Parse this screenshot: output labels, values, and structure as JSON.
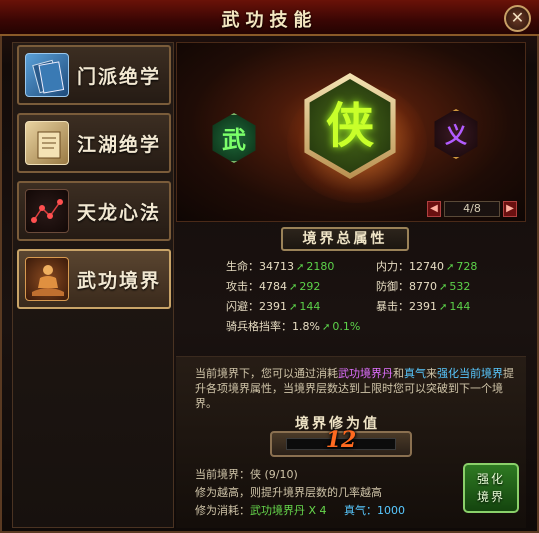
{
  "window": {
    "title": "武功技能"
  },
  "nav": [
    {
      "label": "门派绝学",
      "icon": "book-icon"
    },
    {
      "label": "江湖绝学",
      "icon": "scroll-icon"
    },
    {
      "label": "天龙心法",
      "icon": "constellation-icon"
    },
    {
      "label": "武功境界",
      "icon": "meditation-icon",
      "active": true
    }
  ],
  "realm": {
    "left_char": "武",
    "center_char": "侠",
    "right_char": "义",
    "page": "4/8"
  },
  "attributes": {
    "title": "境界总属性",
    "rows": [
      {
        "label": "生命：",
        "value": "34713",
        "gain": "2180"
      },
      {
        "label": "内力：",
        "value": "12740",
        "gain": "728"
      },
      {
        "label": "攻击：",
        "value": "4784",
        "gain": "292"
      },
      {
        "label": "防御：",
        "value": "8770",
        "gain": "532"
      },
      {
        "label": "闪避：",
        "value": "2391",
        "gain": "144"
      },
      {
        "label": "暴击：",
        "value": "2391",
        "gain": "144"
      },
      {
        "label": "骑兵格挡率：",
        "value": "1.8%",
        "gain": "0.1%"
      }
    ]
  },
  "description": {
    "p1": "当前境界下，您可以通过消耗",
    "item1": "武功境界丹",
    "p2": "和",
    "item2": "真气",
    "p3": "来",
    "item3": "强化当前境界",
    "p4": "提升各项境界属性，当境界层数达到上限时您可以突破到下一个境界。"
  },
  "cultivation": {
    "title": "境界修为值",
    "value": "12",
    "progress": 0
  },
  "status": {
    "current_label": "当前境界：侠 (9/10)",
    "hint": "修为越高，则提升境界层数的几率越高",
    "cost_label": "修为消耗：",
    "cost_item": "武功境界丹 X 4",
    "cost_qi": "真气：1000"
  },
  "buttons": {
    "upgrade_line1": "强化",
    "upgrade_line2": "境界",
    "close": "✕",
    "prev": "◀",
    "next": "▶"
  }
}
